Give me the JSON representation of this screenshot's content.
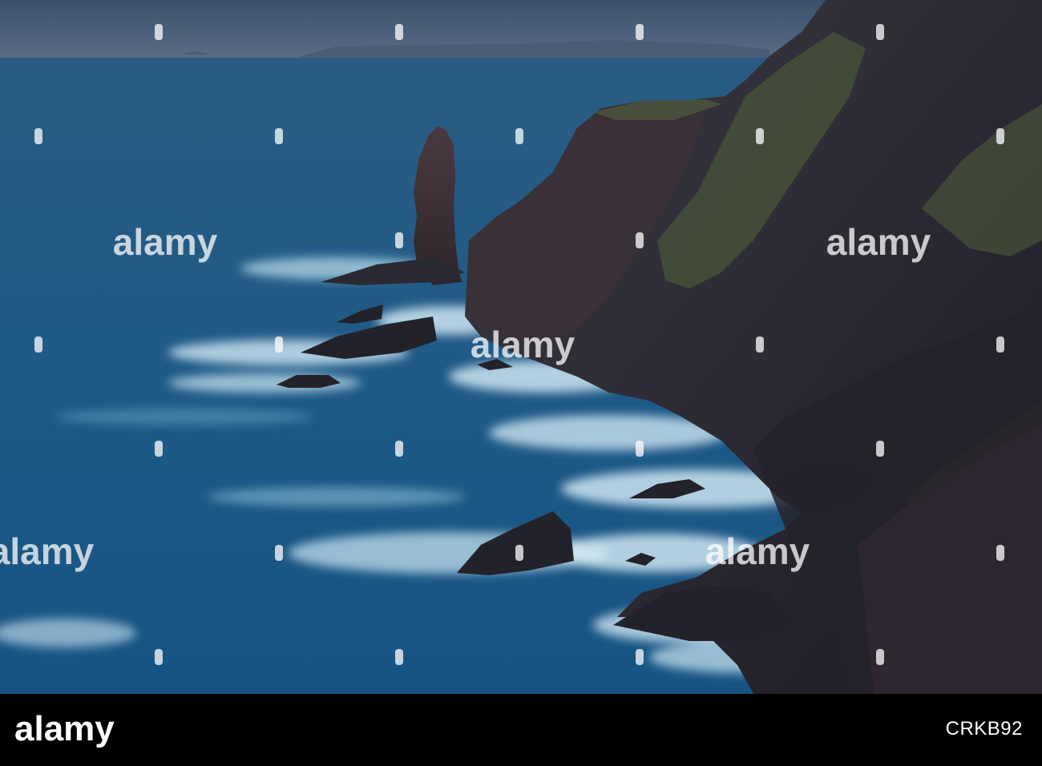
{
  "image": {
    "subject": "sea-stack-and-cliffs",
    "palette": {
      "sky": "#3c5470",
      "sea": "#1f5a84",
      "sea_dark": "#17476d",
      "foam": "#d8eef8",
      "rock": "#2a2a33",
      "rock_red": "#4a3238",
      "grass": "#4c5a3c"
    }
  },
  "watermark": {
    "text": "alamy"
  },
  "footer": {
    "brand": "alamy",
    "image_id": "CRKB92"
  }
}
